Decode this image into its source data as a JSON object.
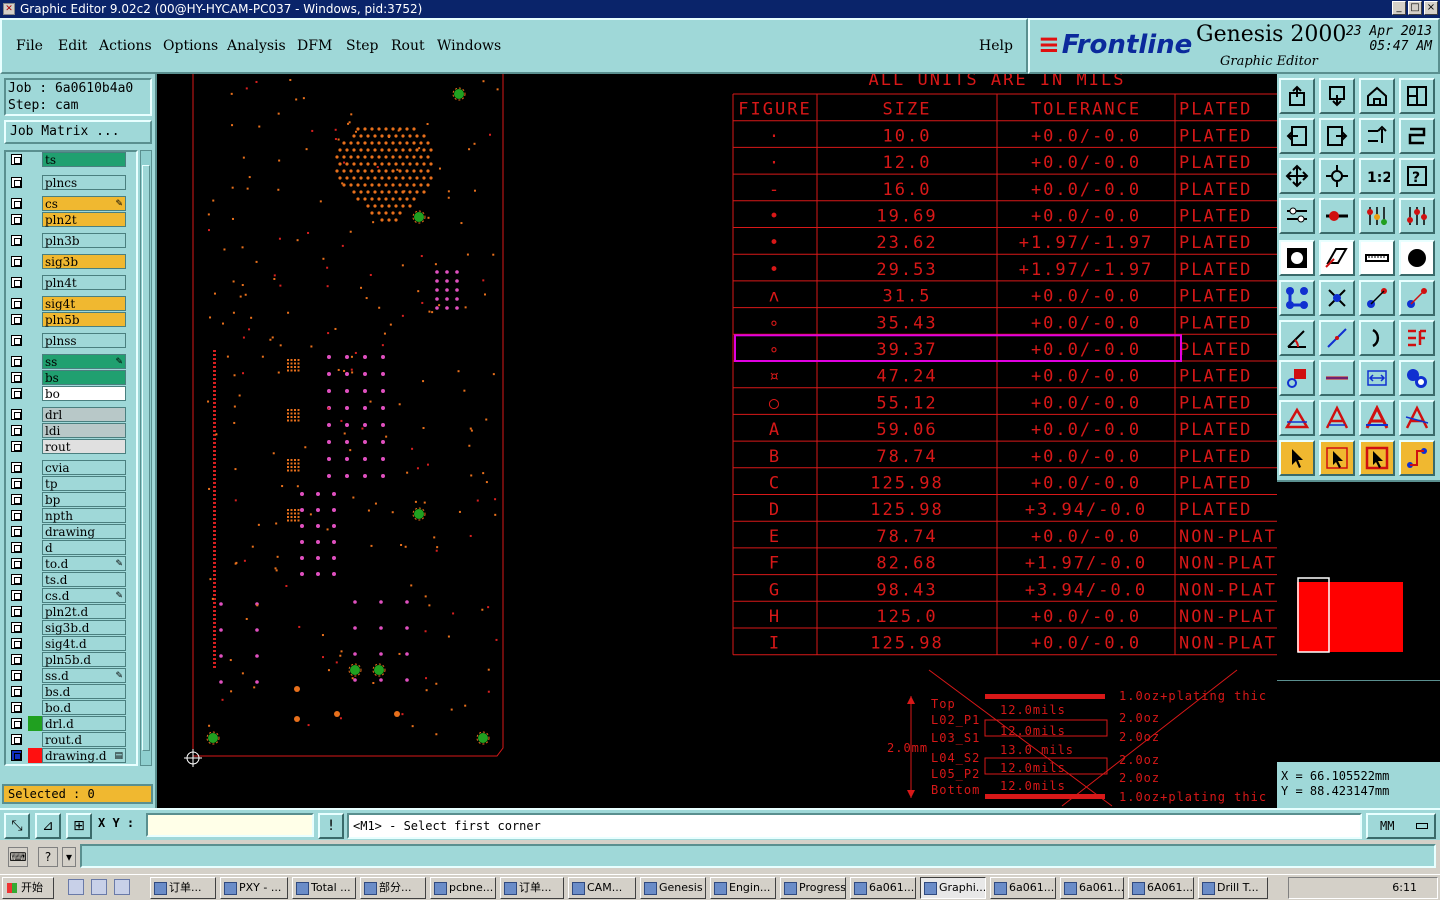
{
  "window": {
    "title": "Graphic Editor 9.02c2 (00@HY-HYCAM-PC037 - Windows, pid:3752)",
    "buttons": [
      "_",
      "□",
      "×"
    ]
  },
  "menu": [
    "File",
    "Edit",
    "Actions",
    "Options",
    "Analysis",
    "DFM",
    "Step",
    "Rout",
    "Windows",
    "Help"
  ],
  "brand": {
    "logo": "Frontline",
    "product": "Genesis 2000",
    "subtitle": "Graphic Editor",
    "date": "23 Apr 2013",
    "time": "05:47 AM"
  },
  "job": {
    "job_line": "Job : 6a0610b4a0",
    "step_line": "Step: cam",
    "matrix_button": "Job Matrix ..."
  },
  "layers": [
    {
      "name": "ts",
      "color": "#20a070",
      "mark": ""
    },
    {
      "name": "plncs",
      "color": "#9fd8d8",
      "mark": ""
    },
    {
      "name": "cs",
      "color": "#f0b830",
      "mark": "✎"
    },
    {
      "name": "pln2t",
      "color": "#f0b830",
      "mark": ""
    },
    {
      "name": "pln3b",
      "color": "#9fd8d8",
      "mark": ""
    },
    {
      "name": "sig3b",
      "color": "#f0b830",
      "mark": ""
    },
    {
      "name": "pln4t",
      "color": "#9fd8d8",
      "mark": ""
    },
    {
      "name": "sig4t",
      "color": "#f0b830",
      "mark": ""
    },
    {
      "name": "pln5b",
      "color": "#f0b830",
      "mark": ""
    },
    {
      "name": "plnss",
      "color": "#9fd8d8",
      "mark": ""
    },
    {
      "name": "ss",
      "color": "#20a070",
      "mark": "✎"
    },
    {
      "name": "bs",
      "color": "#20a070",
      "mark": ""
    },
    {
      "name": "bo",
      "color": "#ffffff",
      "mark": ""
    },
    {
      "name": "drl",
      "color": "#b8c8c8",
      "mark": ""
    },
    {
      "name": "ldi",
      "color": "#b8c8c8",
      "mark": ""
    },
    {
      "name": "rout",
      "color": "#e0e0e0",
      "mark": ""
    },
    {
      "name": "cvia",
      "color": "#9fd8d8",
      "mark": ""
    },
    {
      "name": "tp",
      "color": "#9fd8d8",
      "mark": ""
    },
    {
      "name": "bp",
      "color": "#9fd8d8",
      "mark": ""
    },
    {
      "name": "npth",
      "color": "#9fd8d8",
      "mark": ""
    },
    {
      "name": "drawing",
      "color": "#9fd8d8",
      "mark": ""
    },
    {
      "name": "d",
      "color": "#9fd8d8",
      "mark": ""
    },
    {
      "name": "to.d",
      "color": "#9fd8d8",
      "mark": "✎"
    },
    {
      "name": "ts.d",
      "color": "#9fd8d8",
      "mark": ""
    },
    {
      "name": "cs.d",
      "color": "#9fd8d8",
      "mark": "✎"
    },
    {
      "name": "pln2t.d",
      "color": "#9fd8d8",
      "mark": ""
    },
    {
      "name": "sig3b.d",
      "color": "#9fd8d8",
      "mark": ""
    },
    {
      "name": "sig4t.d",
      "color": "#9fd8d8",
      "mark": ""
    },
    {
      "name": "pln5b.d",
      "color": "#9fd8d8",
      "mark": ""
    },
    {
      "name": "ss.d",
      "color": "#9fd8d8",
      "mark": "✎"
    },
    {
      "name": "bs.d",
      "color": "#9fd8d8",
      "mark": ""
    },
    {
      "name": "bo.d",
      "color": "#9fd8d8",
      "mark": ""
    },
    {
      "name": "drl.d",
      "color": "#9fd8d8",
      "mark": ""
    },
    {
      "name": "rout.d",
      "color": "#9fd8d8",
      "mark": ""
    },
    {
      "name": "drawing.d",
      "color": "#9fd8d8",
      "mark": "▤"
    }
  ],
  "selected": "Selected : 0",
  "drill_table": {
    "caption": "ALL UNITS ARE IN MILS",
    "headers": [
      "FIGURE",
      "SIZE",
      "TOLERANCE",
      "PLATED"
    ],
    "rows": [
      {
        "figure": "·",
        "size": "10.0",
        "tolerance": "+0.0/-0.0",
        "plated": "PLATED"
      },
      {
        "figure": "·",
        "size": "12.0",
        "tolerance": "+0.0/-0.0",
        "plated": "PLATED"
      },
      {
        "figure": "-",
        "size": "16.0",
        "tolerance": "+0.0/-0.0",
        "plated": "PLATED"
      },
      {
        "figure": "•",
        "size": "19.69",
        "tolerance": "+0.0/-0.0",
        "plated": "PLATED"
      },
      {
        "figure": "•",
        "size": "23.62",
        "tolerance": "+1.97/-1.97",
        "plated": "PLATED"
      },
      {
        "figure": "•",
        "size": "29.53",
        "tolerance": "+1.97/-1.97",
        "plated": "PLATED"
      },
      {
        "figure": "ʌ",
        "size": "31.5",
        "tolerance": "+0.0/-0.0",
        "plated": "PLATED"
      },
      {
        "figure": "∘",
        "size": "35.43",
        "tolerance": "+0.0/-0.0",
        "plated": "PLATED"
      },
      {
        "figure": "∘",
        "size": "39.37",
        "tolerance": "+0.0/-0.0",
        "plated": "PLATED"
      },
      {
        "figure": "¤",
        "size": "47.24",
        "tolerance": "+0.0/-0.0",
        "plated": "PLATED"
      },
      {
        "figure": "○",
        "size": "55.12",
        "tolerance": "+0.0/-0.0",
        "plated": "PLATED"
      },
      {
        "figure": "A",
        "size": "59.06",
        "tolerance": "+0.0/-0.0",
        "plated": "PLATED"
      },
      {
        "figure": "B",
        "size": "78.74",
        "tolerance": "+0.0/-0.0",
        "plated": "PLATED"
      },
      {
        "figure": "C",
        "size": "125.98",
        "tolerance": "+0.0/-0.0",
        "plated": "PLATED"
      },
      {
        "figure": "D",
        "size": "125.98",
        "tolerance": "+3.94/-0.0",
        "plated": "PLATED"
      },
      {
        "figure": "E",
        "size": "78.74",
        "tolerance": "+0.0/-0.0",
        "plated": "NON-PLATE"
      },
      {
        "figure": "F",
        "size": "82.68",
        "tolerance": "+1.97/-0.0",
        "plated": "NON-PLATE"
      },
      {
        "figure": "G",
        "size": "98.43",
        "tolerance": "+3.94/-0.0",
        "plated": "NON-PLATE"
      },
      {
        "figure": "H",
        "size": "125.0",
        "tolerance": "+0.0/-0.0",
        "plated": "NON-PLATE"
      },
      {
        "figure": "I",
        "size": "125.98",
        "tolerance": "+0.0/-0.0",
        "plated": "NON-PLATE"
      }
    ],
    "highlighted_row": 8
  },
  "stackup": {
    "layers": [
      "Top",
      "L02_P1",
      "L03_S1",
      "L04_S2",
      "L05_P2",
      "Bottom"
    ],
    "values": [
      "12.0mils",
      "12.0mils",
      "13.0 mils",
      "12.0mils",
      "12.0mils"
    ],
    "copper": [
      "1.0oz+plating thic",
      "2.0oz",
      "2.0oz",
      "2.0oz",
      "2.0oz",
      "1.0oz+plating thic"
    ],
    "thickness": "2.0mm"
  },
  "coords": {
    "x": "X = 66.105522mm",
    "y": "Y = 88.423147mm"
  },
  "bottom": {
    "xy_label": "X Y :",
    "xy_value": "",
    "prompt": "<M1> - Select first corner",
    "units": "MM"
  },
  "taskbar": {
    "start": "开始",
    "tasks": [
      "订单...",
      "PXY - ...",
      "Total ...",
      "部分...",
      "pcbne...",
      "订单...",
      "CAM...",
      "Genesis",
      "Engin...",
      "Progress",
      "6a061...",
      "Graphi...",
      "6a061...",
      "6a061...",
      "6A061...",
      "Drill T..."
    ],
    "active_task": 11,
    "clock": "6:11"
  },
  "colors": {
    "panel": "#9fd8d8",
    "canvas": "#000000",
    "drawing_red": "#d81818",
    "highlight": "#e000e0"
  }
}
